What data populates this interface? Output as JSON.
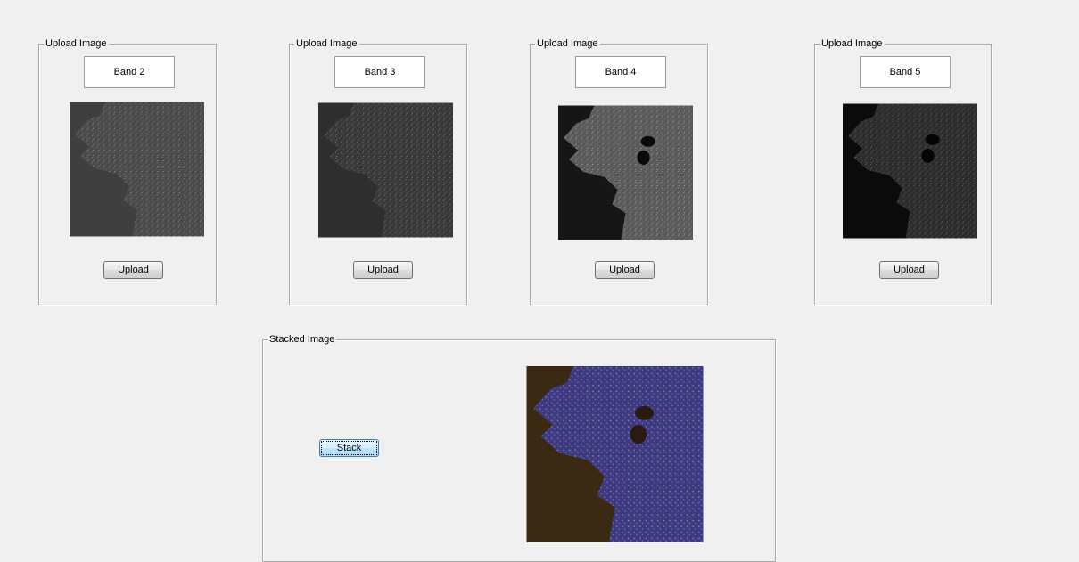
{
  "panels": [
    {
      "title": "Upload Image",
      "band_label": "Band 2",
      "button_label": "Upload"
    },
    {
      "title": "Upload Image",
      "band_label": "Band 3",
      "button_label": "Upload"
    },
    {
      "title": "Upload Image",
      "band_label": "Band 4",
      "button_label": "Upload"
    },
    {
      "title": "Upload Image",
      "band_label": "Band 5",
      "button_label": "Upload"
    }
  ],
  "stacked": {
    "title": "Stacked Image",
    "button_label": "Stack"
  }
}
